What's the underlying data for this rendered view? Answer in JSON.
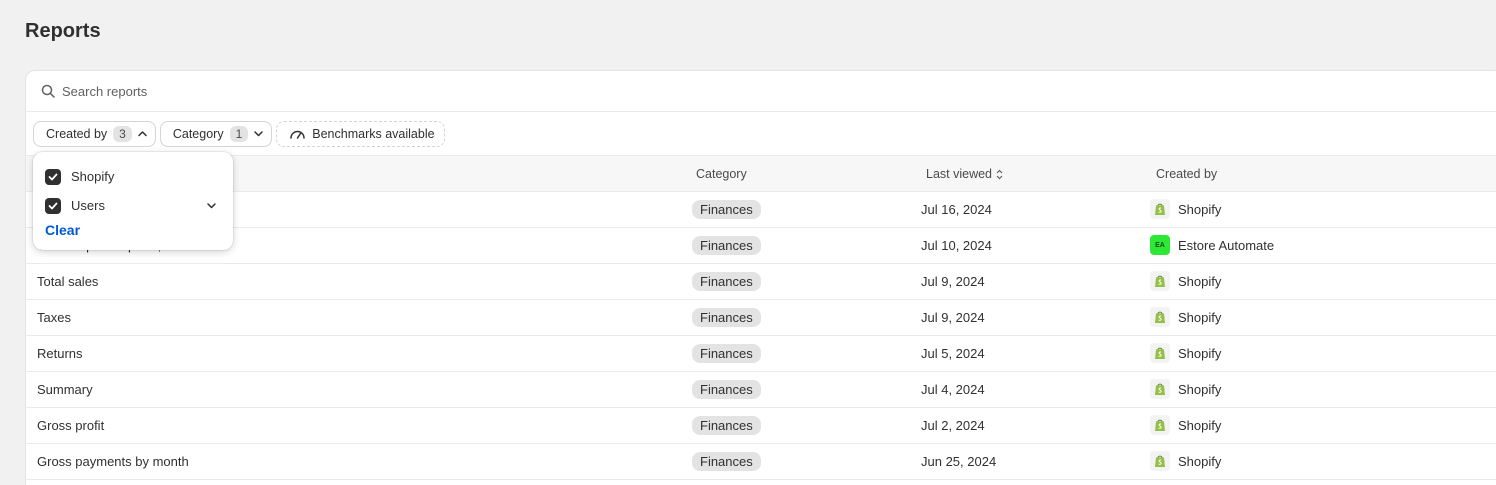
{
  "page": {
    "title": "Reports"
  },
  "search": {
    "placeholder": "Search reports",
    "icon": "search-icon"
  },
  "filters": {
    "created_by": {
      "label": "Created by",
      "count": "3"
    },
    "category": {
      "label": "Category",
      "count": "1"
    },
    "benchmarks": {
      "label": "Benchmarks available",
      "icon": "gauge-icon"
    }
  },
  "popover": {
    "options": [
      {
        "label": "Shopify",
        "checked": true
      },
      {
        "label": "Users",
        "checked": true
      }
    ],
    "clear_label": "Clear"
  },
  "table": {
    "columns": {
      "category": "Category",
      "last_viewed": "Last viewed",
      "created_by": "Created by"
    },
    "rows": [
      {
        "name": "",
        "category": "Finances",
        "last_viewed": "Jul 16, 2024",
        "creator": "Shopify",
        "creator_logo": "shopify-icon"
      },
      {
        "name": "Taxes report - Apr 28, 2024",
        "category": "Finances",
        "last_viewed": "Jul 10, 2024",
        "creator": "Estore Automate",
        "creator_logo": "EA"
      },
      {
        "name": "Total sales",
        "category": "Finances",
        "last_viewed": "Jul 9, 2024",
        "creator": "Shopify",
        "creator_logo": "shopify-icon"
      },
      {
        "name": "Taxes",
        "category": "Finances",
        "last_viewed": "Jul 9, 2024",
        "creator": "Shopify",
        "creator_logo": "shopify-icon"
      },
      {
        "name": "Returns",
        "category": "Finances",
        "last_viewed": "Jul 5, 2024",
        "creator": "Shopify",
        "creator_logo": "shopify-icon"
      },
      {
        "name": "Summary",
        "category": "Finances",
        "last_viewed": "Jul 4, 2024",
        "creator": "Shopify",
        "creator_logo": "shopify-icon"
      },
      {
        "name": "Gross profit",
        "category": "Finances",
        "last_viewed": "Jul 2, 2024",
        "creator": "Shopify",
        "creator_logo": "shopify-icon"
      },
      {
        "name": "Gross payments by month",
        "category": "Finances",
        "last_viewed": "Jun 25, 2024",
        "creator": "Shopify",
        "creator_logo": "shopify-icon"
      }
    ]
  },
  "colors": {
    "accent": "#005bd3",
    "shopify_green": "#95bf47",
    "ea_green": "#2ee836"
  }
}
